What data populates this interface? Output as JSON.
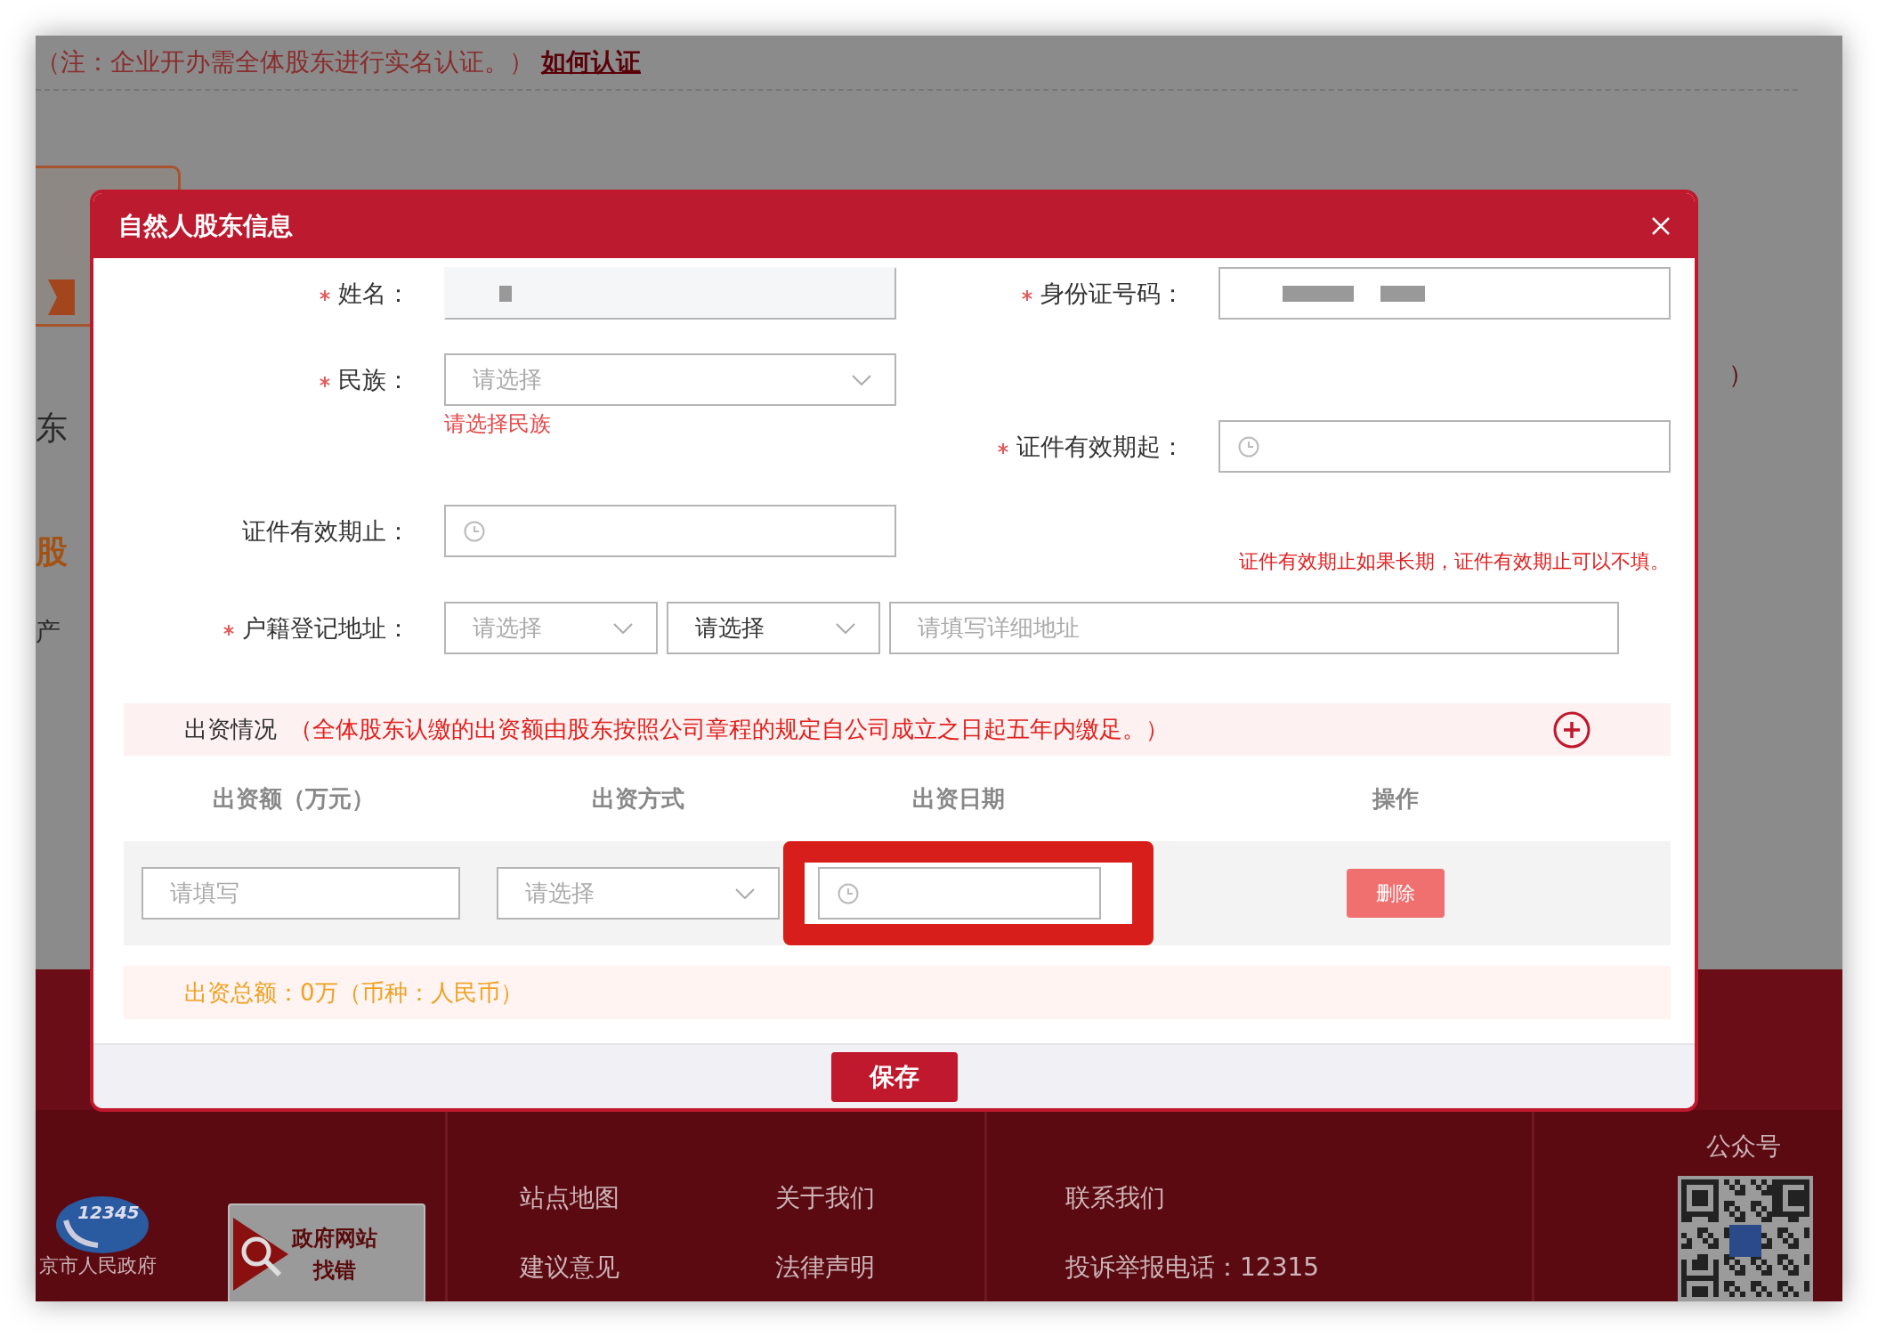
{
  "background_page": {
    "notice": "（注：企业开办需全体股东进行实名认证。）",
    "notice_link": "如何认证",
    "left_fragments": [
      {
        "text": "东",
        "kind": "plain"
      },
      {
        "text": "股",
        "kind": "accent"
      },
      {
        "text": "产",
        "kind": "plain"
      }
    ],
    "right_fragment": "）",
    "footer": {
      "logo_number": "12345",
      "logo_caption": "京市人民政府",
      "badge_lines": [
        "政府网站",
        "找错"
      ],
      "links": [
        "站点地图",
        "关于我们",
        "建议意见",
        "法律声明"
      ],
      "contact": [
        "联系我们",
        "投诉举报电话：12315"
      ],
      "qr_caption": "公众号"
    }
  },
  "dialog": {
    "title": "自然人股东信息",
    "left_fields": [
      {
        "label": "姓名：",
        "required": true,
        "kind": "text",
        "masked": true
      },
      {
        "label": "民族：",
        "required": true,
        "kind": "select",
        "placeholder": "请选择",
        "error": "请选择民族"
      },
      {
        "label": "证件有效期止：",
        "required": false,
        "kind": "date"
      }
    ],
    "right_fields": [
      {
        "label": "身份证号码：",
        "required": true,
        "kind": "text",
        "masked": true
      },
      {
        "label": "证件有效期起：",
        "required": true,
        "kind": "date"
      }
    ],
    "hint": "证件有效期止如果长期，证件有效期止可以不填。",
    "address": {
      "label": "户籍登记地址：",
      "required": true,
      "province": {
        "placeholder": "请选择"
      },
      "city": {
        "value": "请选择"
      },
      "detail": {
        "placeholder": "请填写详细地址"
      }
    },
    "contribution": {
      "title": "出资情况",
      "note": "（全体股东认缴的出资额由股东按照公司章程的规定自公司成立之日起五年内缴足。）",
      "columns": [
        "出资额（万元）",
        "出资方式",
        "出资日期",
        "操作"
      ],
      "rows": [
        {
          "amount_placeholder": "请填写",
          "method_placeholder": "请选择",
          "date_highlighted": true,
          "action": "删除"
        }
      ],
      "total": "出资总额：0万（币种：人民币）"
    },
    "save": "保存"
  }
}
